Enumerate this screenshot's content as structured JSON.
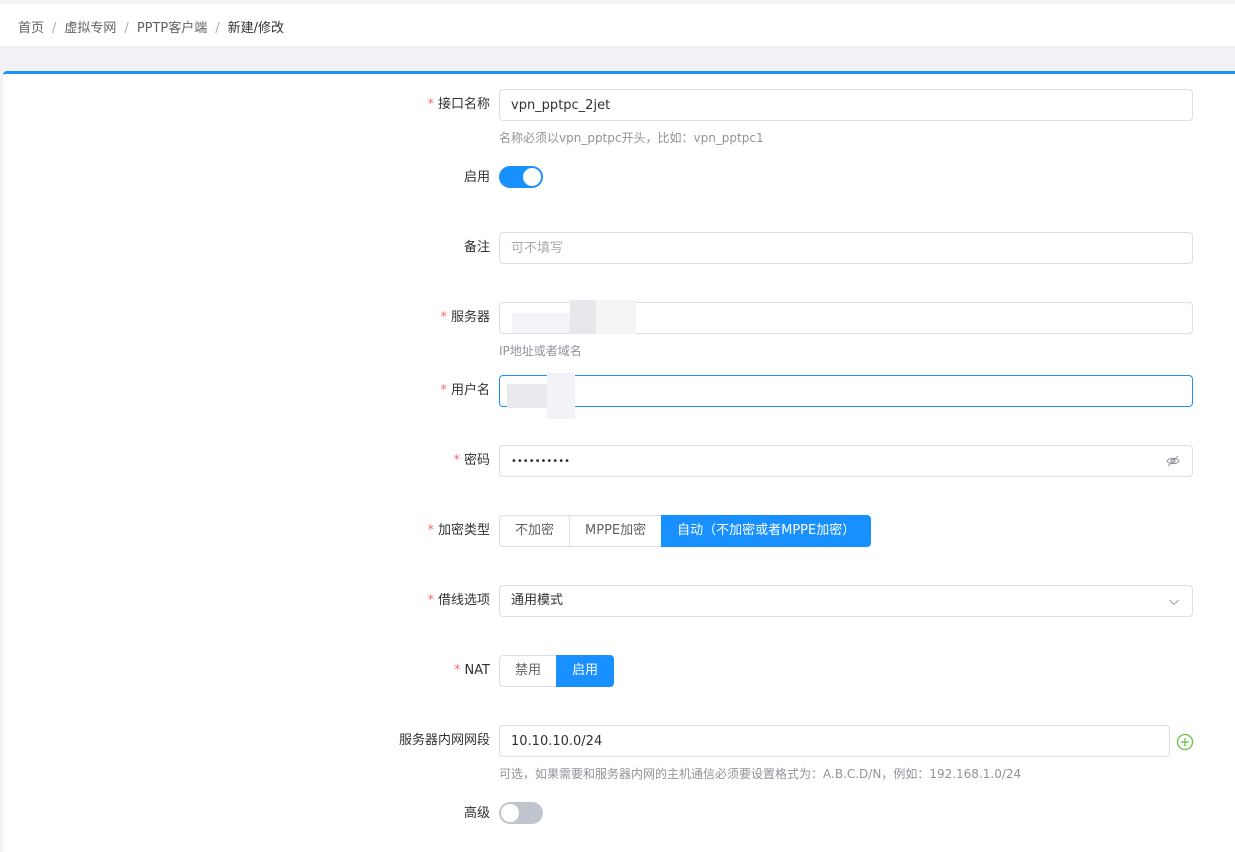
{
  "breadcrumb": {
    "items": [
      "首页",
      "虚拟专网",
      "PPTP客户端",
      "新建/修改"
    ],
    "separator": "/"
  },
  "form": {
    "interface_name": {
      "label": "接口名称",
      "value": "vpn_pptpc_2jet",
      "hint": "名称必须以vpn_pptpc开头，比如：vpn_pptpc1"
    },
    "enable": {
      "label": "启用",
      "on": true
    },
    "remark": {
      "label": "备注",
      "placeholder": "可不填写",
      "value": ""
    },
    "server": {
      "label": "服务器",
      "value": "",
      "hint": "IP地址或者域名"
    },
    "username": {
      "label": "用户名",
      "value": ""
    },
    "password": {
      "label": "密码",
      "value": "••••••••••"
    },
    "encryption": {
      "label": "加密类型",
      "options": [
        "不加密",
        "MPPE加密",
        "自动（不加密或者MPPE加密）"
      ],
      "selected": 2
    },
    "line_option": {
      "label": "借线选项",
      "value": "通用模式"
    },
    "nat": {
      "label": "NAT",
      "options": [
        "禁用",
        "启用"
      ],
      "selected": 1
    },
    "server_subnet": {
      "label": "服务器内网网段",
      "value": "10.10.10.0/24",
      "hint": "可选，如果需要和服务器内网的主机通信必须要设置格式为：A.B.C.D/N，例如：192.168.1.0/24"
    },
    "advanced": {
      "label": "高级",
      "on": false
    }
  },
  "colors": {
    "primary": "#1890ff",
    "required": "#f56c6c",
    "add_icon": "#67c23a"
  }
}
